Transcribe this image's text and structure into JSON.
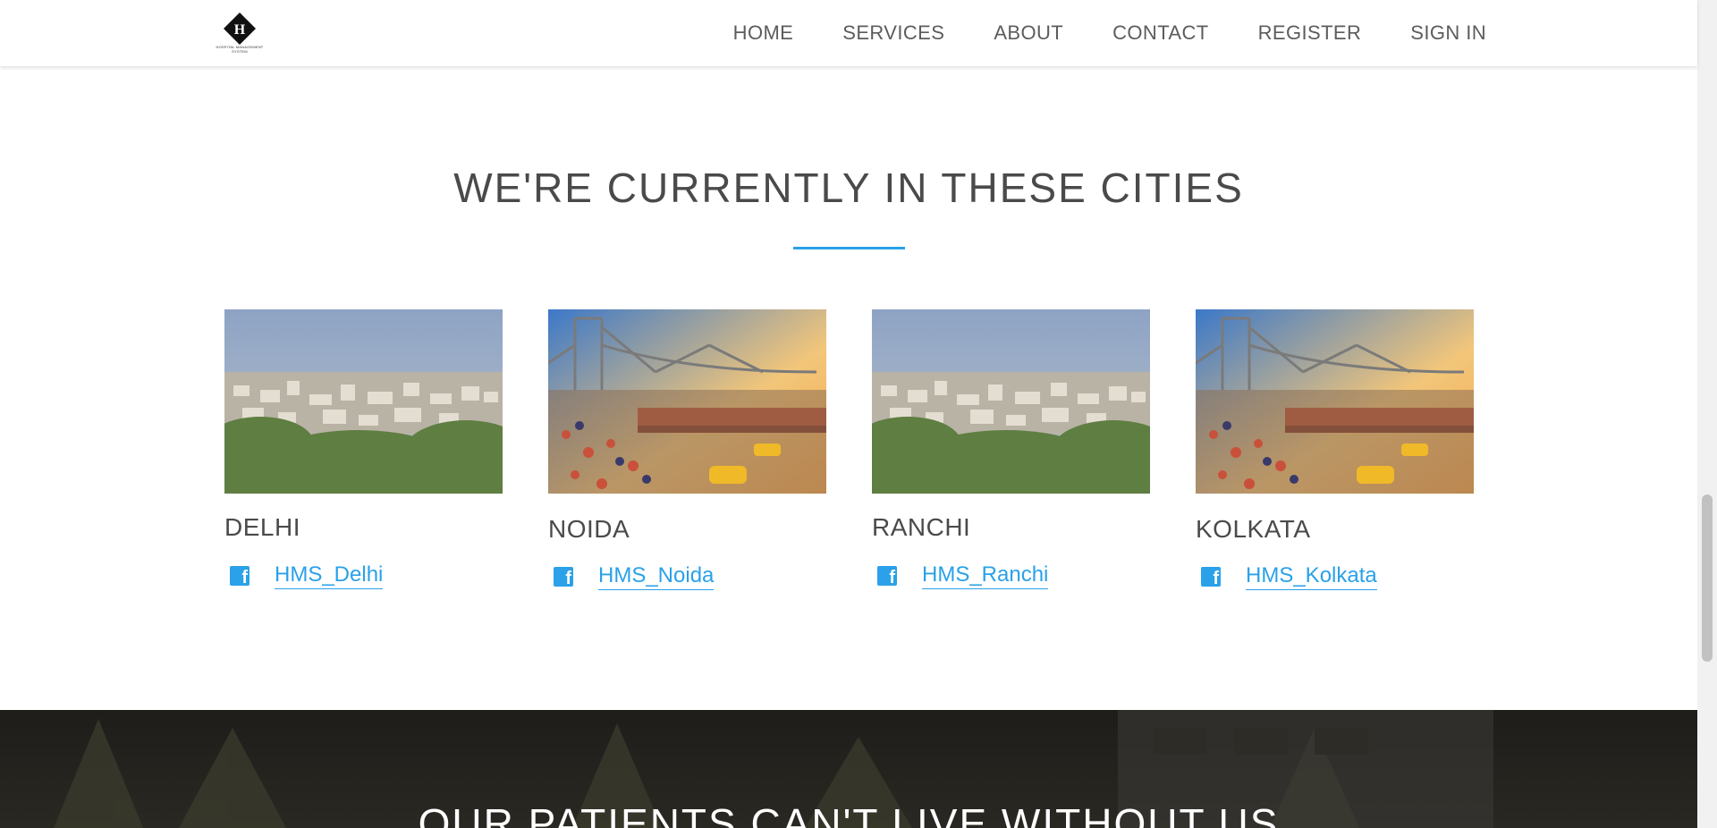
{
  "header": {
    "logo_letter": "H",
    "logo_caption": "HOSPITAL MANAGEMENT SYSTEM",
    "nav": [
      "HOME",
      "SERVICES",
      "ABOUT",
      "CONTACT",
      "REGISTER",
      "SIGN IN"
    ]
  },
  "cities_section": {
    "title": "WE'RE CURRENTLY IN THESE CITIES",
    "accent_color": "#2aa1e8",
    "cities": [
      {
        "name": "DELHI",
        "link": "HMS_Delhi",
        "image": "city-skyline"
      },
      {
        "name": "NOIDA",
        "link": "HMS_Noida",
        "image": "bridge-market"
      },
      {
        "name": "RANCHI",
        "link": "HMS_Ranchi",
        "image": "city-skyline"
      },
      {
        "name": "KOLKATA",
        "link": "HMS_Kolkata",
        "image": "bridge-market"
      }
    ]
  },
  "testimonials": {
    "title": "OUR PATIENTS CAN'T LIVE WITHOUT US"
  }
}
